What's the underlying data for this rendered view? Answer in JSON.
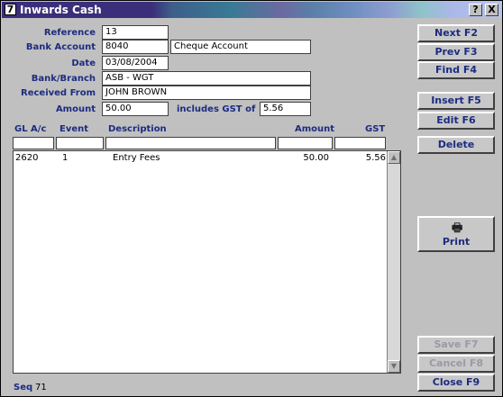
{
  "window": {
    "title": "Inwards Cash",
    "icon_text": "7"
  },
  "title_buttons": {
    "help": "?",
    "close": "X"
  },
  "form": {
    "reference": {
      "label": "Reference",
      "value": "13"
    },
    "bank_account": {
      "label": "Bank Account",
      "value": "8040",
      "name": "Cheque Account"
    },
    "date": {
      "label": "Date",
      "value": "03/08/2004"
    },
    "bank_branch": {
      "label": "Bank/Branch",
      "value": "ASB - WGT"
    },
    "received_from": {
      "label": "Received From",
      "value": "JOHN BROWN"
    },
    "amount": {
      "label": "Amount",
      "value": "50.00"
    },
    "gst": {
      "label": "includes GST of",
      "value": "5.56"
    }
  },
  "table": {
    "headers": {
      "gl": "GL A/c",
      "event": "Event",
      "description": "Description",
      "amount": "Amount",
      "gst": "GST"
    },
    "rows": [
      {
        "gl": "2620",
        "event": "1",
        "description": "Entry Fees",
        "amount": "50.00",
        "gst": "5.56"
      }
    ]
  },
  "buttons": {
    "next": "Next F2",
    "prev": "Prev F3",
    "find": "Find F4",
    "insert": "Insert F5",
    "edit": "Edit F6",
    "delete": "Delete",
    "print": "Print",
    "save": "Save F7",
    "cancel": "Cancel F8",
    "close": "Close F9"
  },
  "status": {
    "seq_label": "Seq",
    "seq_value": "71"
  }
}
